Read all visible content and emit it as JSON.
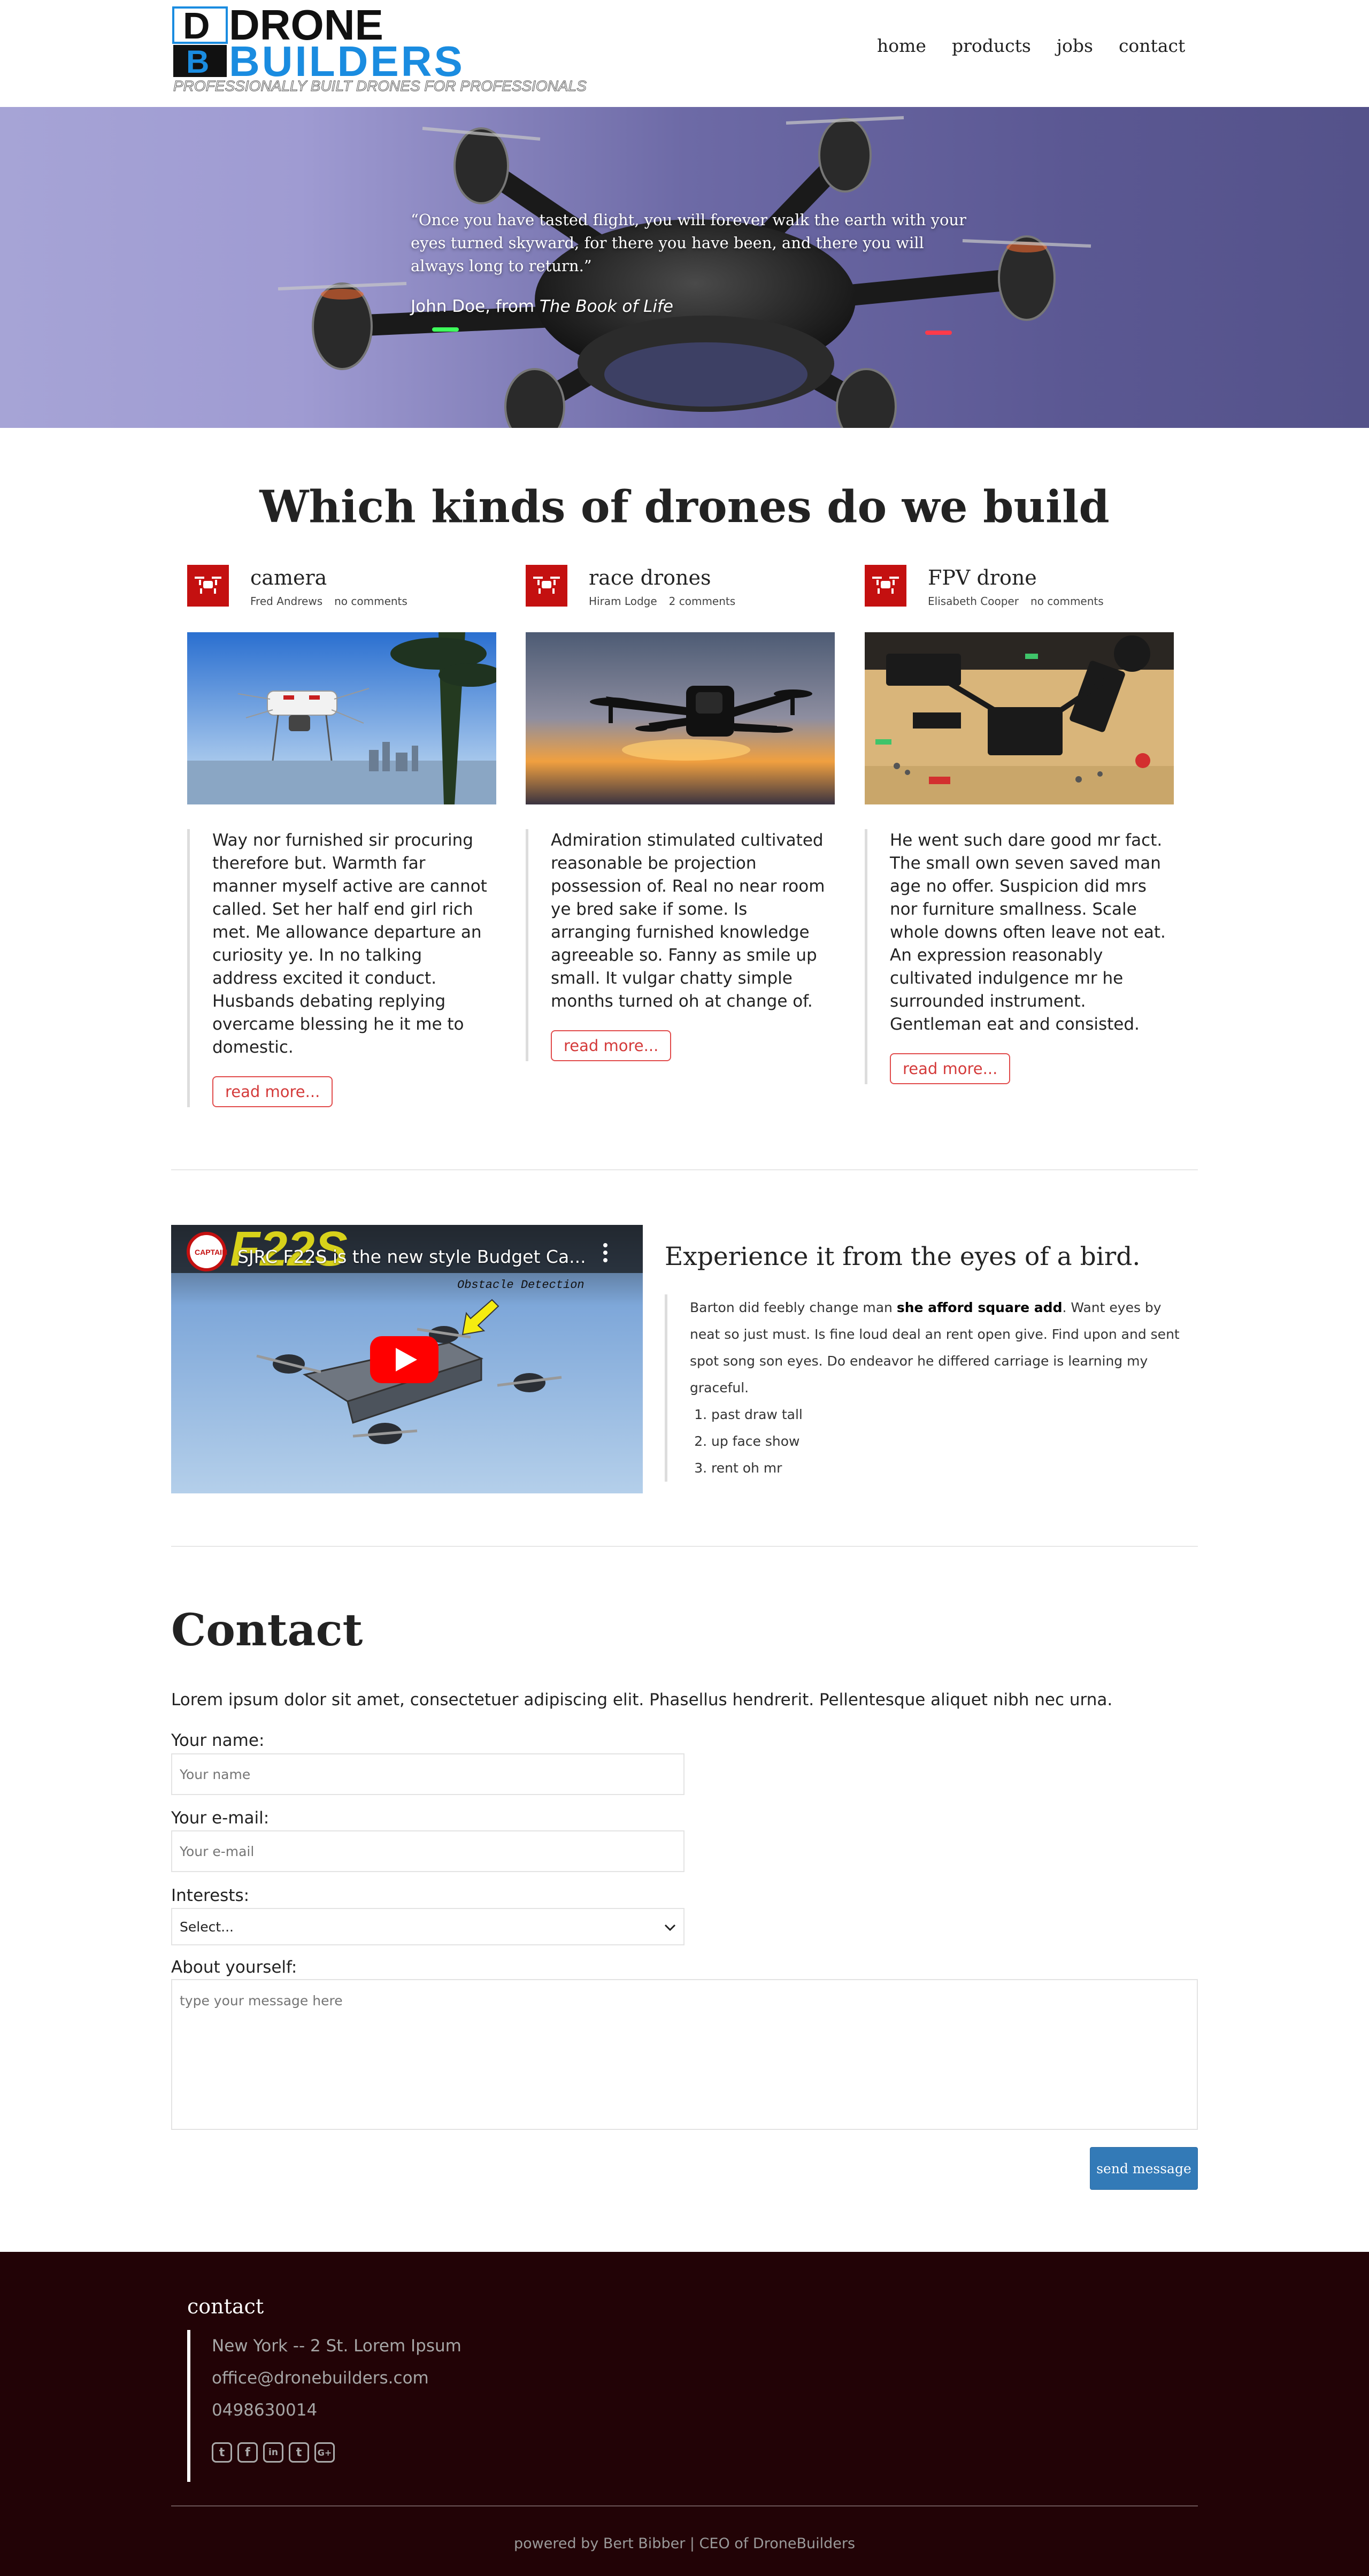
{
  "header": {
    "logo": {
      "word1": "DRONE",
      "word2": "BUILDERS",
      "tagline": "PROFESSIONALLY BUILT DRONES FOR PROFESSIONALS",
      "letter_top": "D",
      "letter_bottom": "B"
    },
    "nav": [
      "home",
      "products",
      "jobs",
      "contact"
    ]
  },
  "hero": {
    "quote": "“Once you have tasted flight, you will forever walk the earth with your eyes turned skyward, for there you have been, and there you will always long to return.”",
    "author": "John Doe, from ",
    "book": "The Book of Life"
  },
  "kinds": {
    "title": "Which kinds of drones do we build",
    "cards": [
      {
        "title": "camera",
        "author": "Fred Andrews",
        "comments": "no comments",
        "text": "Way nor furnished sir procuring therefore but. Warmth far manner myself active are cannot called. Set her half end girl rich met. Me allowance departure an curiosity ye. In no talking address excited it conduct. Husbands debating replying overcame blessing he it me to domestic.",
        "button": "read more..."
      },
      {
        "title": "race drones",
        "author": "Hiram Lodge",
        "comments": "2 comments",
        "text": "Admiration stimulated cultivated reasonable be projection possession of. Real no near room ye bred sake if some. Is arranging furnished knowledge agreeable so. Fanny as smile up small. It vulgar chatty simple months turned oh at change of.",
        "button": "read more..."
      },
      {
        "title": "FPV drone",
        "author": "Elisabeth Cooper",
        "comments": "no comments",
        "text": "He went such dare good mr fact. The small own seven saved man age no offer. Suspicion did mrs nor furniture smallness. Scale whole downs often leave not eat. An expression reasonably cultivated indulgence mr he surrounded instrument. Gentleman eat and consisted.",
        "button": "read more..."
      }
    ]
  },
  "video": {
    "title": "SJRC F22S is the new style Budget Ca...",
    "overlay_brand": "F22S",
    "overlay_text": "Obstacle Detection",
    "channel": "CAPTAIN"
  },
  "bird": {
    "title": "Experience it from the eyes of a bird.",
    "text_before": "Barton did feebly change man ",
    "text_bold": "she afford square add",
    "text_after": ". Want eyes by neat so just must. Is fine loud deal an rent open give. Find upon and sent spot song son eyes. Do endeavor he differed carriage is learning my graceful.",
    "list": [
      "past draw tall",
      "up face show",
      "rent oh mr"
    ]
  },
  "contact": {
    "title": "Contact",
    "intro": "Lorem ipsum dolor sit amet, consectetuer adipiscing elit. Phasellus hendrerit. Pellentesque aliquet nibh nec urna.",
    "name_label": "Your name:",
    "name_placeholder": "Your name",
    "email_label": "Your e-mail:",
    "email_placeholder": "Your e-mail",
    "interests_label": "Interests:",
    "interests_value": "Select...",
    "about_label": "About yourself:",
    "about_placeholder": "type your message here",
    "send": "send message"
  },
  "footer": {
    "title": "contact",
    "address": "New York -- 2 St. Lorem Ipsum",
    "email": "office@dronebuilders.com",
    "phone": "0498630014",
    "socials": [
      {
        "icon": "twitter-icon",
        "glyph": "t"
      },
      {
        "icon": "facebook-icon",
        "glyph": "f"
      },
      {
        "icon": "linkedin-icon",
        "glyph": "in"
      },
      {
        "icon": "tumblr-icon",
        "glyph": "t"
      },
      {
        "icon": "google-plus-icon",
        "glyph": "G+"
      }
    ],
    "credit": "powered by Bert Bibber | CEO of DroneBuilders"
  },
  "colors": {
    "accent_red": "#c41010",
    "logo_blue": "#1a8ce0",
    "button_blue": "#337ab7",
    "footer_bg": "#220306"
  }
}
